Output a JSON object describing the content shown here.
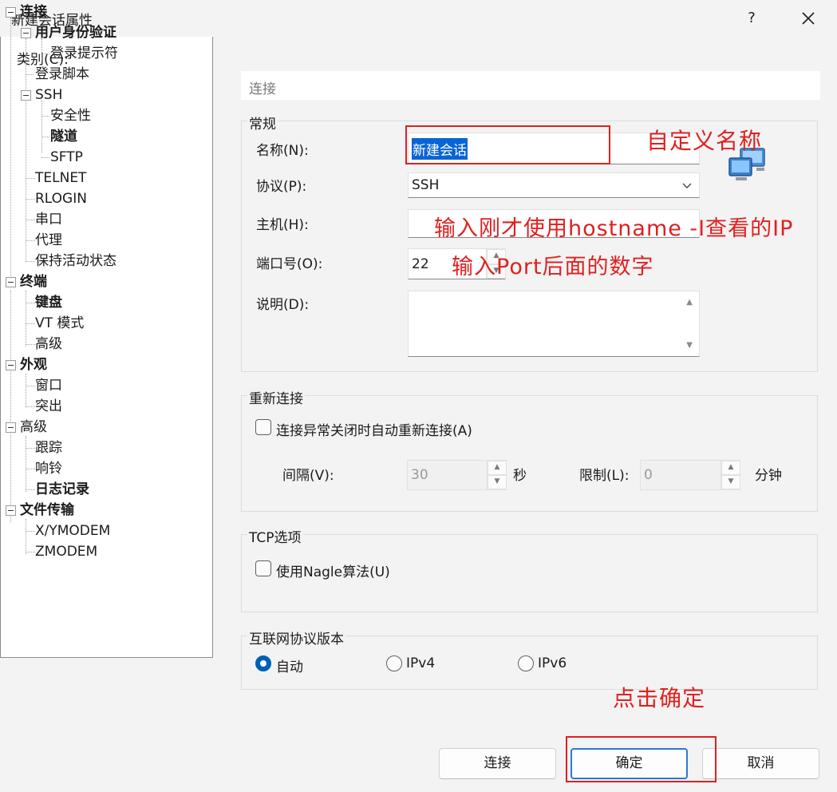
{
  "window": {
    "title": "新建会话属性",
    "help": "?",
    "close": "✕"
  },
  "category_label": "类别(C):",
  "tree": [
    {
      "label": "连接",
      "bold": true
    },
    {
      "label": "用户身份验证",
      "bold": true
    },
    {
      "label": "登录提示符",
      "bold": false
    },
    {
      "label": "登录脚本",
      "bold": false
    },
    {
      "label": "SSH",
      "bold": false
    },
    {
      "label": "安全性",
      "bold": false
    },
    {
      "label": "隧道",
      "bold": true
    },
    {
      "label": "SFTP",
      "bold": false
    },
    {
      "label": "TELNET",
      "bold": false
    },
    {
      "label": "RLOGIN",
      "bold": false
    },
    {
      "label": "串口",
      "bold": false
    },
    {
      "label": "代理",
      "bold": false
    },
    {
      "label": "保持活动状态",
      "bold": false
    },
    {
      "label": "终端",
      "bold": true
    },
    {
      "label": "键盘",
      "bold": true
    },
    {
      "label": "VT 模式",
      "bold": false
    },
    {
      "label": "高级",
      "bold": false
    },
    {
      "label": "外观",
      "bold": true
    },
    {
      "label": "窗口",
      "bold": false
    },
    {
      "label": "突出",
      "bold": false
    },
    {
      "label": "高级",
      "bold": false
    },
    {
      "label": "跟踪",
      "bold": false
    },
    {
      "label": "响铃",
      "bold": false
    },
    {
      "label": "日志记录",
      "bold": true
    },
    {
      "label": "文件传输",
      "bold": true
    },
    {
      "label": "X/YMODEM",
      "bold": false
    },
    {
      "label": "ZMODEM",
      "bold": false
    }
  ],
  "panel": {
    "header": "连接",
    "general": {
      "title": "常规",
      "name_label": "名称(N):",
      "name_value": "新建会话",
      "protocol_label": "协议(P):",
      "protocol_value": "SSH",
      "host_label": "主机(H):",
      "host_value": "",
      "port_label": "端口号(O):",
      "port_value": "22",
      "desc_label": "说明(D):",
      "desc_value": ""
    },
    "reconnect": {
      "title": "重新连接",
      "auto_label": "连接异常关闭时自动重新连接(A)",
      "auto_checked": false,
      "interval_label": "间隔(V):",
      "interval_value": "30",
      "interval_unit": "秒",
      "limit_label": "限制(L):",
      "limit_value": "0",
      "limit_unit": "分钟"
    },
    "tcp": {
      "title": "TCP选项",
      "nagle_label": "使用Nagle算法(U)",
      "nagle_checked": false
    },
    "ip": {
      "title": "互联网协议版本",
      "options": [
        "自动",
        "IPv4",
        "IPv6"
      ],
      "selected": "自动"
    }
  },
  "buttons": {
    "connect": "连接",
    "ok": "确定",
    "cancel": "取消"
  },
  "annotations": {
    "name": "自定义名称",
    "host": "输入刚才使用hostname -I查看的IP",
    "port": "输入Port后面的数字",
    "ok": "点击确定"
  },
  "colors": {
    "annotation": "#e02020",
    "selection": "#0a64d6",
    "accent": "#005fb8"
  }
}
